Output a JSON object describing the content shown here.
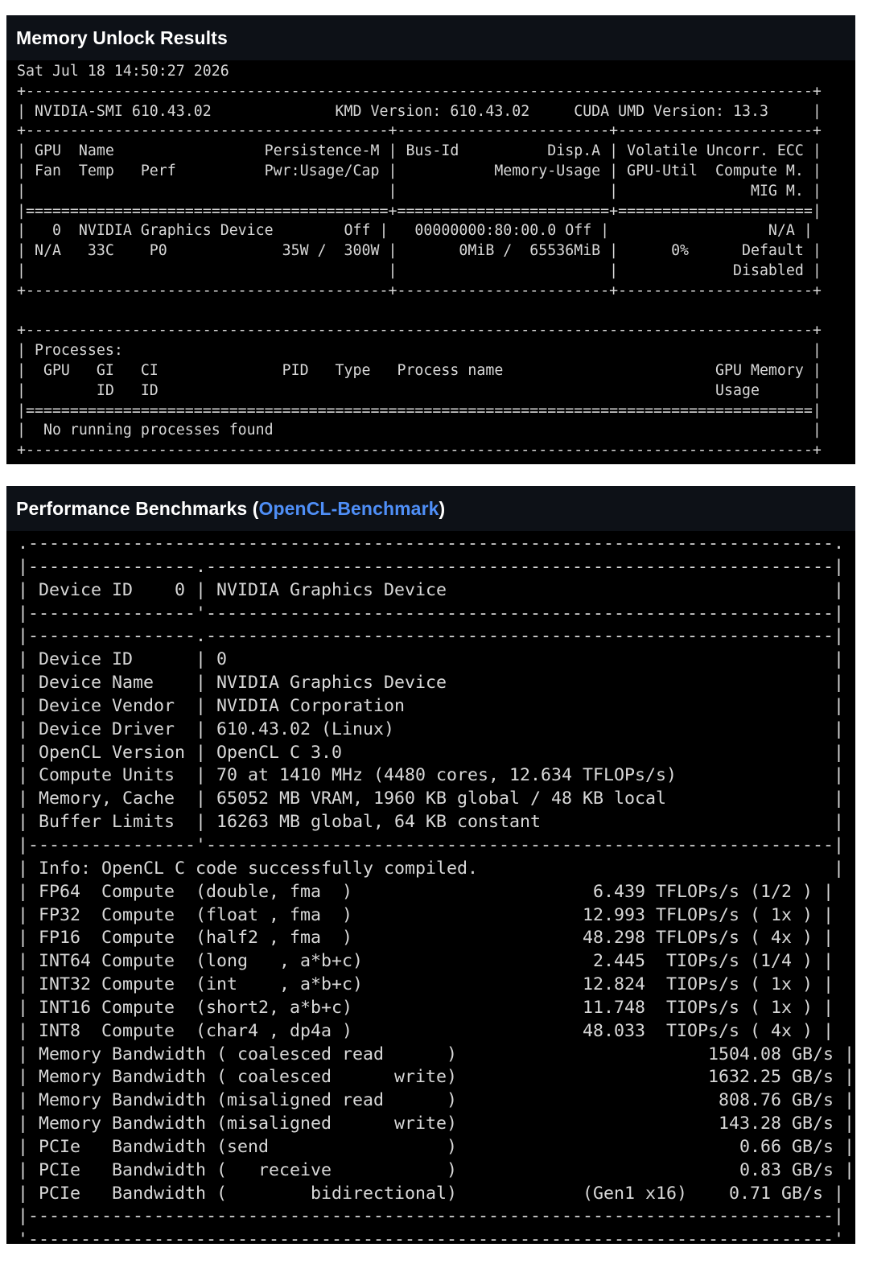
{
  "smi_section": {
    "title": "Memory Unlock Results",
    "lines": [
      "Sat Jul 18 14:50:27 2026",
      "+-----------------------------------------------------------------------------------------+",
      "| NVIDIA-SMI 610.43.02              KMD Version: 610.43.02     CUDA UMD Version: 13.3     |",
      "+-----------------------------------------+------------------------+----------------------+",
      "| GPU  Name                 Persistence-M | Bus-Id          Disp.A | Volatile Uncorr. ECC |",
      "| Fan  Temp   Perf          Pwr:Usage/Cap |           Memory-Usage | GPU-Util  Compute M. |",
      "|                                         |                        |               MIG M. |",
      "|=========================================+========================+======================|",
      "|   0  NVIDIA Graphics Device        Off |   00000000:80:00.0 Off |                  N/A |",
      "| N/A   33C    P0             35W /  300W |       0MiB /  65536MiB |      0%      Default |",
      "|                                         |                        |             Disabled |",
      "+-----------------------------------------+------------------------+----------------------+",
      "",
      "+-----------------------------------------------------------------------------------------+",
      "| Processes:                                                                              |",
      "|  GPU   GI   CI              PID   Type   Process name                        GPU Memory |",
      "|        ID   ID                                                               Usage      |",
      "|=========================================================================================|",
      "|  No running processes found                                                             |",
      "+-----------------------------------------------------------------------------------------+"
    ]
  },
  "bench_section": {
    "title_prefix": "Performance Benchmarks (",
    "title_link": "OpenCL-Benchmark",
    "title_suffix": ")",
    "lines": [
      ".-----------------------------------------------------------------------------.",
      "|----------------.------------------------------------------------------------|",
      "| Device ID    0 | NVIDIA Graphics Device                                     |",
      "|----------------'------------------------------------------------------------|",
      "|----------------.------------------------------------------------------------|",
      "| Device ID      | 0                                                          |",
      "| Device Name    | NVIDIA Graphics Device                                     |",
      "| Device Vendor  | NVIDIA Corporation                                         |",
      "| Device Driver  | 610.43.02 (Linux)                                          |",
      "| OpenCL Version | OpenCL C 3.0                                               |",
      "| Compute Units  | 70 at 1410 MHz (4480 cores, 12.634 TFLOPs/s)               |",
      "| Memory, Cache  | 65052 MB VRAM, 1960 KB global / 48 KB local                |",
      "| Buffer Limits  | 16263 MB global, 64 KB constant                            |",
      "|----------------'------------------------------------------------------------|",
      "| Info: OpenCL C code successfully compiled.                                  |",
      "| FP64  Compute  (double, fma  )                       6.439 TFLOPs/s (1/2 ) |",
      "| FP32  Compute  (float , fma  )                      12.993 TFLOPs/s ( 1x ) |",
      "| FP16  Compute  (half2 , fma  )                      48.298 TFLOPs/s ( 4x ) |",
      "| INT64 Compute  (long   , a*b+c)                      2.445  TIOPs/s (1/4 ) |",
      "| INT32 Compute  (int    , a*b+c)                     12.824  TIOPs/s ( 1x ) |",
      "| INT16 Compute  (short2, a*b+c)                      11.748  TIOPs/s ( 1x ) |",
      "| INT8  Compute  (char4 , dp4a )                      48.033  TIOPs/s ( 4x ) |",
      "| Memory Bandwidth ( coalesced read      )                        1504.08 GB/s |",
      "| Memory Bandwidth ( coalesced      write)                        1632.25 GB/s |",
      "| Memory Bandwidth (misaligned read      )                         808.76 GB/s |",
      "| Memory Bandwidth (misaligned      write)                         143.28 GB/s |",
      "| PCIe   Bandwidth (send                 )                           0.66 GB/s |",
      "| PCIe   Bandwidth (   receive           )                           0.83 GB/s |",
      "| PCIe   Bandwidth (        bidirectional)            (Gen1 x16)    0.71 GB/s |",
      "|-----------------------------------------------------------------------------|",
      "'-----------------------------------------------------------------------------'"
    ]
  }
}
